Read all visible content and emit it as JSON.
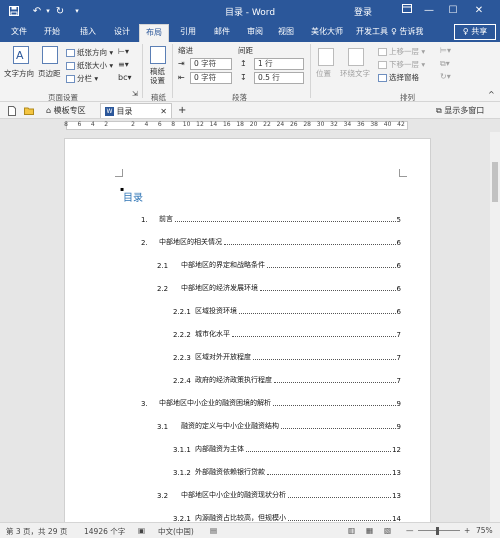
{
  "title_bar": {
    "title": "目录 - Word",
    "login": "登录",
    "save_icon": "save-icon",
    "undo_icon": "undo-icon",
    "redo_icon": "redo-icon",
    "customize_icon": "chevron-down-icon",
    "ribbon_display_icon": "ribbon-display-icon",
    "minimize": "—",
    "maximize": "☐",
    "close": "✕",
    "bg_color": "#2b579a"
  },
  "ribbon_tabs": [
    "文件",
    "开始",
    "插入",
    "设计",
    "布局",
    "引用",
    "邮件",
    "审阅",
    "视图",
    "美化大师",
    "开发工具"
  ],
  "active_tab": "布局",
  "tell_me": "♀ 告诉我",
  "share": "♀ 共享",
  "ribbon": {
    "page_setup": {
      "text_direction": "文字方向",
      "margins": "页边距",
      "orientation": "纸张方向 ▾",
      "size": "纸张大小 ▾",
      "columns": "分栏 ▾",
      "label": "页面设置"
    },
    "manuscript": {
      "button": "稿纸\n设置",
      "label": "稿纸"
    },
    "paragraph": {
      "indent_header": "缩进",
      "spacing_header": "间距",
      "indent_left": "0 字符",
      "indent_right": "0 字符",
      "spacing_before": "1 行",
      "spacing_after": "0.5 行",
      "label": "段落"
    },
    "arrange": {
      "position": "位置",
      "wrap_text": "环绕文字",
      "bring_forward": "上移一层 ▾",
      "send_backward": "下移一层 ▾",
      "selection_pane": "选择窗格",
      "label": "排列"
    }
  },
  "doc_tabs": {
    "template": "模板专区",
    "current": "目录",
    "add": "+",
    "show_multi": "显示多窗口"
  },
  "ruler": {
    "numbers": [
      "8",
      "6",
      "4",
      "2",
      "",
      "2",
      "4",
      "6",
      "8",
      "10",
      "12",
      "14",
      "16",
      "18",
      "20",
      "22",
      "24",
      "26",
      "28",
      "30",
      "32",
      "34",
      "36",
      "38",
      "40",
      "42"
    ]
  },
  "document": {
    "toc_title": "目录",
    "entries": [
      {
        "num": "1.",
        "text": "前言",
        "page": "5",
        "level": 1
      },
      {
        "num": "2.",
        "text": "中部地区的相关情况",
        "page": "6",
        "level": 1
      },
      {
        "num": "2.1",
        "text": "中部地区的界定和战略条件",
        "page": "6",
        "level": 2
      },
      {
        "num": "2.2",
        "text": "中部地区的经济发展环境",
        "page": "6",
        "level": 2
      },
      {
        "num": "2.2.1",
        "text": "区域投资环境",
        "page": "6",
        "level": 3
      },
      {
        "num": "2.2.2",
        "text": "城市化水平",
        "page": "7",
        "level": 3
      },
      {
        "num": "2.2.3",
        "text": "区域对外开放程度",
        "page": "7",
        "level": 3
      },
      {
        "num": "2.2.4",
        "text": "政府的经济政策执行程度",
        "page": "7",
        "level": 3
      },
      {
        "num": "3.",
        "text": "中部地区中小企业的融资困境的解析",
        "page": "9",
        "level": 1
      },
      {
        "num": "3.1",
        "text": "融资的定义与中小企业融资结构",
        "page": "9",
        "level": 2
      },
      {
        "num": "3.1.1",
        "text": "内部融资为主体",
        "page": "12",
        "level": 3
      },
      {
        "num": "3.1.2",
        "text": "外部融资依赖银行贷款",
        "page": "13",
        "level": 3
      },
      {
        "num": "3.2",
        "text": "中部地区中小企业的融资现状分析",
        "page": "13",
        "level": 2
      },
      {
        "num": "3.2.1",
        "text": "内源融资占比较高，但规模小",
        "page": "14",
        "level": 3
      }
    ]
  },
  "status_bar": {
    "page": "第 3 页，共 29 页",
    "words": "14926 个字",
    "language": "中文(中国)",
    "zoom_minus": "—",
    "zoom_plus": "+",
    "zoom": "75%"
  }
}
